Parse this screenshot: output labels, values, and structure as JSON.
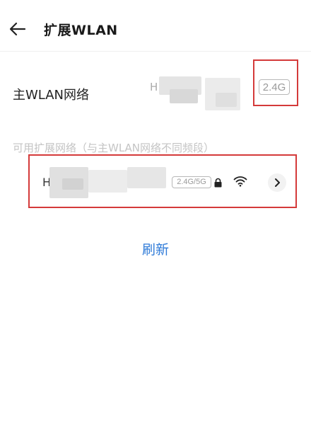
{
  "header": {
    "title": "扩展WLAN"
  },
  "main_network": {
    "label": "主WLAN网络",
    "ssid_prefix": "H",
    "band": "2.4G"
  },
  "extended": {
    "section_label": "可用扩展网络（与主WLAN网络不同频段）",
    "networks": [
      {
        "ssid_prefix": "H",
        "band": "2.4G/5G"
      }
    ]
  },
  "actions": {
    "refresh_label": "刷新"
  },
  "icons": {
    "back": "back-arrow-icon",
    "lock": "lock-icon",
    "wifi": "wifi-signal-icon",
    "chevron": "chevron-right-icon"
  },
  "colors": {
    "accent": "#2f7bd8",
    "highlight": "#d43a3a"
  }
}
